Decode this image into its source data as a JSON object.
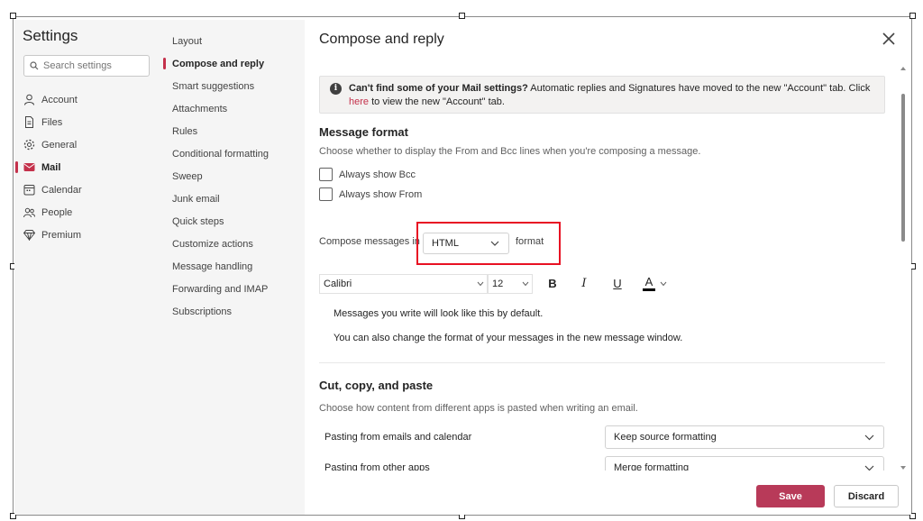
{
  "settings_nav": {
    "title": "Settings",
    "search_placeholder": "Search settings",
    "items": [
      {
        "label": "Account",
        "icon": "person-icon"
      },
      {
        "label": "Files",
        "icon": "file-icon"
      },
      {
        "label": "General",
        "icon": "gear-icon"
      },
      {
        "label": "Mail",
        "icon": "mail-icon",
        "active": true
      },
      {
        "label": "Calendar",
        "icon": "calendar-icon"
      },
      {
        "label": "People",
        "icon": "people-icon"
      },
      {
        "label": "Premium",
        "icon": "diamond-icon"
      }
    ]
  },
  "mail_nav": {
    "items": [
      "Layout",
      "Compose and reply",
      "Smart suggestions",
      "Attachments",
      "Rules",
      "Conditional formatting",
      "Sweep",
      "Junk email",
      "Quick steps",
      "Customize actions",
      "Message handling",
      "Forwarding and IMAP",
      "Subscriptions"
    ],
    "active": "Compose and reply"
  },
  "main": {
    "title": "Compose and reply",
    "info": {
      "bold": "Can't find some of your Mail settings?",
      "text": " Automatic replies and Signatures have moved to the new \"Account\" tab. Click",
      "link": "here",
      "text2": " to view the new \"Account\" tab."
    },
    "message_format": {
      "title": "Message format",
      "description": "Choose whether to display the From and Bcc lines when you're composing a message.",
      "checkbox_bcc": "Always show Bcc",
      "checkbox_from": "Always show From",
      "compose_prefix": "Compose messages in",
      "compose_value": "HTML",
      "compose_suffix": "format",
      "font": "Calibri",
      "font_size": "12",
      "bold_label": "B",
      "italic_label": "I",
      "underline_label": "U",
      "font_color_label": "A",
      "preview_line1": "Messages you write will look like this by default.",
      "preview_line2": "You can also change the format of your messages in the new message window."
    },
    "cut_copy_paste": {
      "title": "Cut, copy, and paste",
      "description": "Choose how content from different apps is pasted when writing an email.",
      "rows": [
        {
          "label": "Pasting from emails and calendar",
          "value": "Keep source formatting"
        },
        {
          "label": "Pasting from other apps",
          "value": "Merge formatting"
        }
      ]
    },
    "footer": {
      "save": "Save",
      "discard": "Discard"
    }
  },
  "colors": {
    "accent": "#c4314b",
    "save_button": "#b83a59",
    "highlight_box": "#e81123"
  }
}
